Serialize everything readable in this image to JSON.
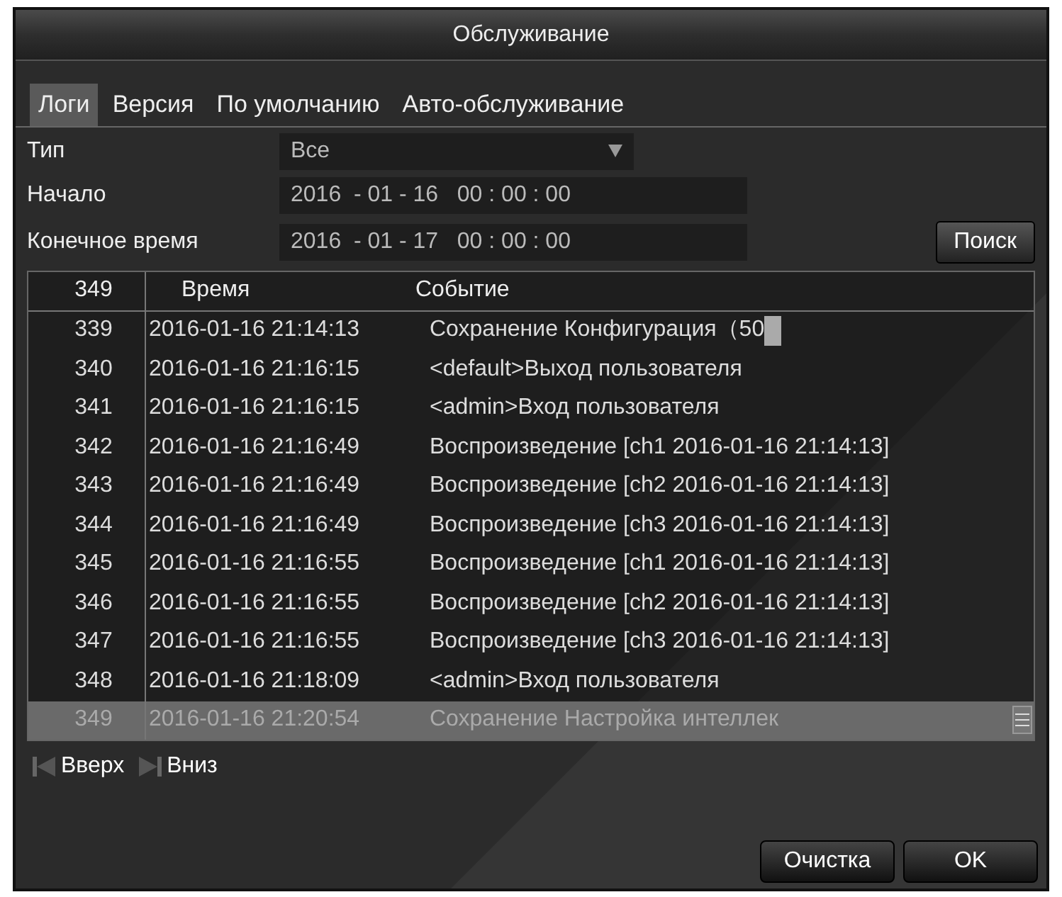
{
  "window": {
    "title": "Обслуживание"
  },
  "tabs": [
    {
      "label": "Логи",
      "selected": true
    },
    {
      "label": "Версия",
      "selected": false
    },
    {
      "label": "По умолчанию",
      "selected": false
    },
    {
      "label": "Авто-обслуживание",
      "selected": false
    }
  ],
  "filters": {
    "type_label": "Тип",
    "type_value": "Все",
    "start_label": "Начало",
    "start": {
      "year": "2016",
      "month": "01",
      "day": "16",
      "hour": "00",
      "minute": "00",
      "second": "00"
    },
    "end_label": "Конечное время",
    "end": {
      "year": "2016",
      "month": "01",
      "day": "17",
      "hour": "00",
      "minute": "00",
      "second": "00"
    },
    "separators": {
      "date": "-",
      "time": ":"
    },
    "search_button": "Поиск"
  },
  "table": {
    "columns": [
      "349",
      "Время",
      "Событие"
    ],
    "rows": [
      {
        "num": "339",
        "time": "2016-01-16 21:14:13",
        "event": "Сохранение Конфигурация（50",
        "cursor": true,
        "selected": false
      },
      {
        "num": "340",
        "time": "2016-01-16 21:16:15",
        "event": "<default>Выход пользователя",
        "cursor": false,
        "selected": false
      },
      {
        "num": "341",
        "time": "2016-01-16 21:16:15",
        "event": "<admin>Вход пользователя",
        "cursor": false,
        "selected": false
      },
      {
        "num": "342",
        "time": "2016-01-16 21:16:49",
        "event": "Воспроизведение [ch1 2016-01-16 21:14:13]",
        "cursor": false,
        "selected": false
      },
      {
        "num": "343",
        "time": "2016-01-16 21:16:49",
        "event": "Воспроизведение [ch2 2016-01-16 21:14:13]",
        "cursor": false,
        "selected": false
      },
      {
        "num": "344",
        "time": "2016-01-16 21:16:49",
        "event": "Воспроизведение [ch3 2016-01-16 21:14:13]",
        "cursor": false,
        "selected": false
      },
      {
        "num": "345",
        "time": "2016-01-16 21:16:55",
        "event": "Воспроизведение [ch1 2016-01-16 21:14:13]",
        "cursor": false,
        "selected": false
      },
      {
        "num": "346",
        "time": "2016-01-16 21:16:55",
        "event": "Воспроизведение [ch2 2016-01-16 21:14:13]",
        "cursor": false,
        "selected": false
      },
      {
        "num": "347",
        "time": "2016-01-16 21:16:55",
        "event": "Воспроизведение [ch3 2016-01-16 21:14:13]",
        "cursor": false,
        "selected": false
      },
      {
        "num": "348",
        "time": "2016-01-16 21:18:09",
        "event": "<admin>Вход пользователя",
        "cursor": false,
        "selected": false
      },
      {
        "num": "349",
        "time": "2016-01-16 21:20:54",
        "event": "Сохранение Настройка интеллек",
        "cursor": false,
        "selected": true
      }
    ]
  },
  "paging": {
    "up": "Вверх",
    "down": "Вниз"
  },
  "buttons": [
    "Очистка",
    "OK"
  ]
}
